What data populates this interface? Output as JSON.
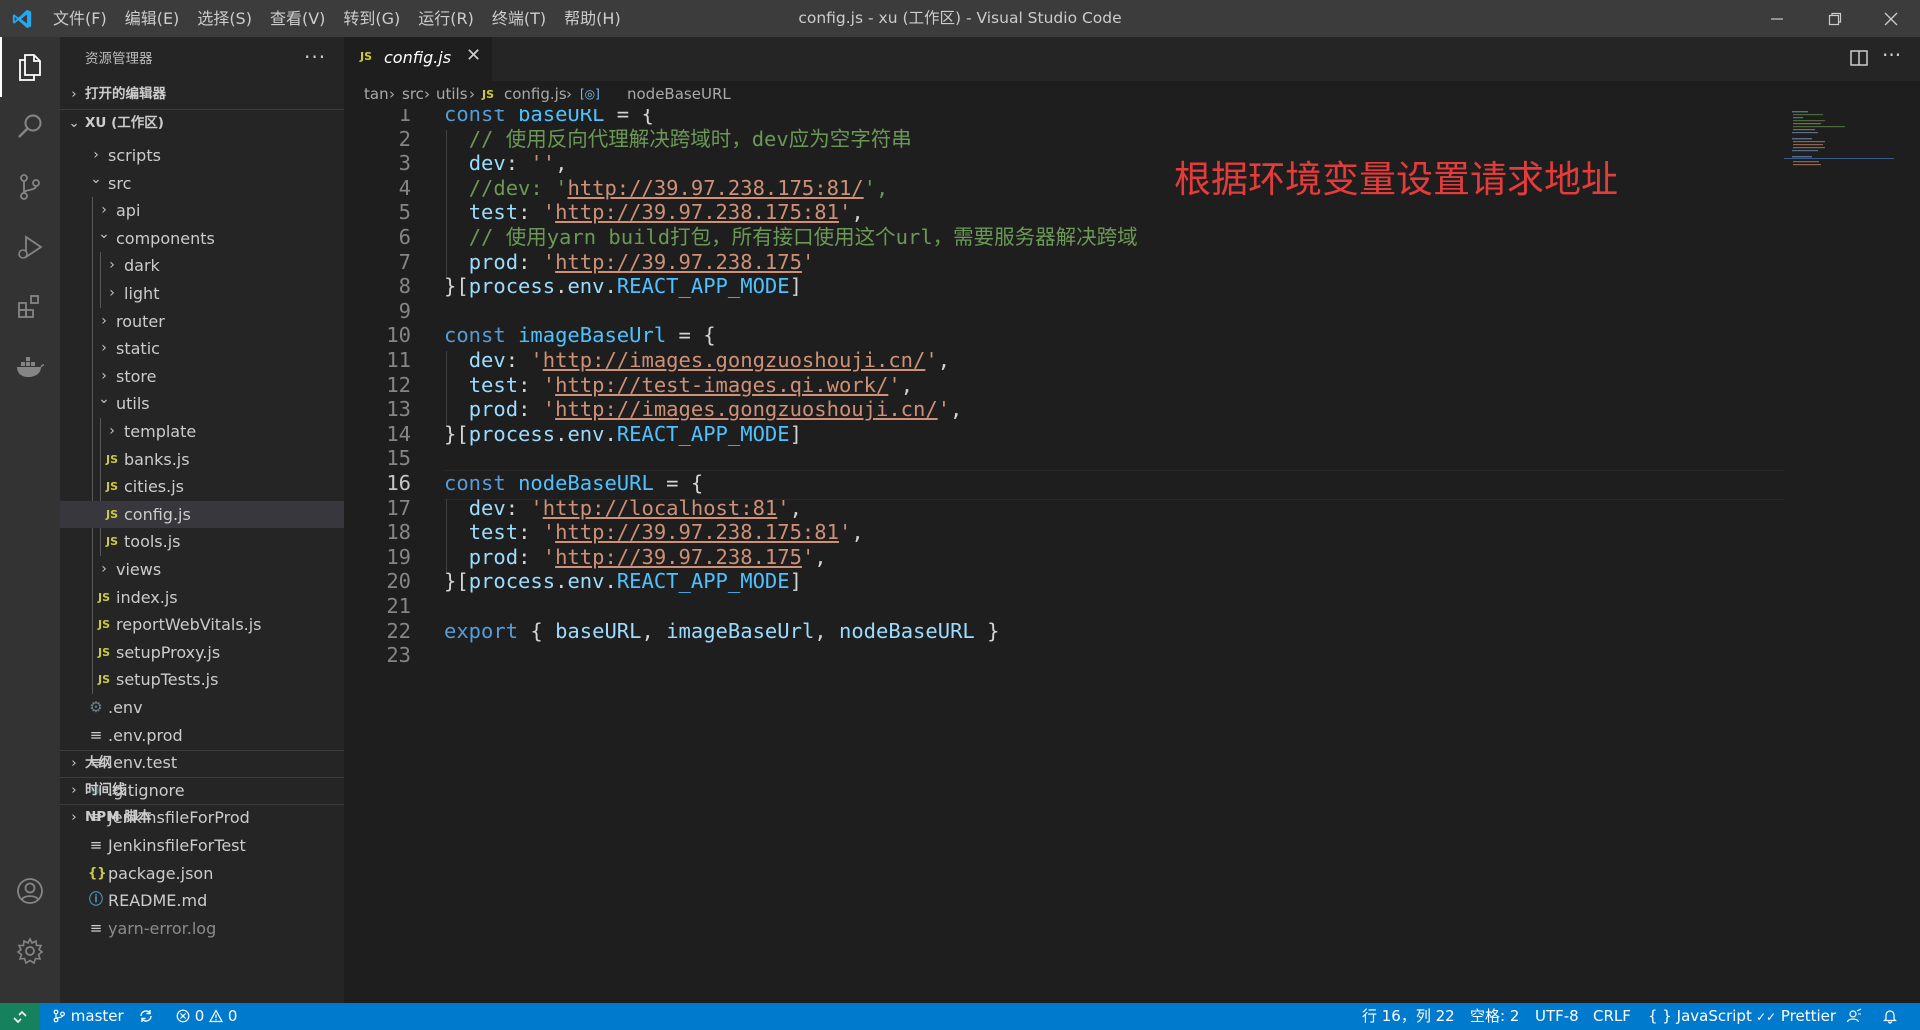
{
  "titlebar": {
    "window_title": "config.js - xu (工作区) - Visual Studio Code",
    "menus": [
      "文件(F)",
      "编辑(E)",
      "选择(S)",
      "查看(V)",
      "转到(G)",
      "运行(R)",
      "终端(T)",
      "帮助(H)"
    ]
  },
  "sidebar": {
    "title": "资源管理器",
    "open_editors": "打开的编辑器",
    "workspace": "XU (工作区)",
    "outline": "大纲",
    "timeline": "时间线",
    "npm_scripts": "NPM 脚本",
    "tree": [
      {
        "name": "scripts",
        "indent": 2,
        "type": "folder-closed"
      },
      {
        "name": "src",
        "indent": 2,
        "type": "folder-open"
      },
      {
        "name": "api",
        "indent": 3,
        "type": "folder-closed"
      },
      {
        "name": "components",
        "indent": 3,
        "type": "folder-open"
      },
      {
        "name": "dark",
        "indent": 4,
        "type": "folder-closed"
      },
      {
        "name": "light",
        "indent": 4,
        "type": "folder-closed"
      },
      {
        "name": "router",
        "indent": 3,
        "type": "folder-closed"
      },
      {
        "name": "static",
        "indent": 3,
        "type": "folder-closed"
      },
      {
        "name": "store",
        "indent": 3,
        "type": "folder-closed"
      },
      {
        "name": "utils",
        "indent": 3,
        "type": "folder-open"
      },
      {
        "name": "template",
        "indent": 4,
        "type": "folder-closed"
      },
      {
        "name": "banks.js",
        "indent": 4,
        "type": "js"
      },
      {
        "name": "cities.js",
        "indent": 4,
        "type": "js"
      },
      {
        "name": "config.js",
        "indent": 4,
        "type": "js",
        "selected": true
      },
      {
        "name": "tools.js",
        "indent": 4,
        "type": "js"
      },
      {
        "name": "views",
        "indent": 3,
        "type": "folder-closed"
      },
      {
        "name": "index.js",
        "indent": 3,
        "type": "js"
      },
      {
        "name": "reportWebVitals.js",
        "indent": 3,
        "type": "js"
      },
      {
        "name": "setupProxy.js",
        "indent": 3,
        "type": "js"
      },
      {
        "name": "setupTests.js",
        "indent": 3,
        "type": "js"
      },
      {
        "name": ".env",
        "indent": 2,
        "type": "gear"
      },
      {
        "name": ".env.prod",
        "indent": 2,
        "type": "lines"
      },
      {
        "name": ".env.test",
        "indent": 2,
        "type": "lines"
      },
      {
        "name": ".gitignore",
        "indent": 2,
        "type": "git"
      },
      {
        "name": "JenkinsfileForProd",
        "indent": 2,
        "type": "lines"
      },
      {
        "name": "JenkinsfileForTest",
        "indent": 2,
        "type": "lines"
      },
      {
        "name": "package.json",
        "indent": 2,
        "type": "json"
      },
      {
        "name": "README.md",
        "indent": 2,
        "type": "info"
      },
      {
        "name": "yarn-error.log",
        "indent": 2,
        "type": "lines",
        "dim": true
      }
    ],
    "icon_glyphs": {
      "js": "JS",
      "gear": "⚙",
      "lines": "≡",
      "git": "◆",
      "json": "{}",
      "info": "ⓘ"
    }
  },
  "editor": {
    "tab_label": "config.js",
    "tab_icon": "JS",
    "breadcrumbs": [
      "tan",
      "src",
      "utils",
      "config.js",
      "nodeBaseURL"
    ],
    "annotation": "根据环境变量设置请求地址",
    "active_line": 16,
    "lines": [
      [
        [
          "kw",
          "const "
        ],
        [
          "var",
          "baseURL"
        ],
        [
          "punc",
          " = {"
        ]
      ],
      [
        [
          "punc",
          "  "
        ],
        [
          "cmt",
          "// 使用反向代理解决跨域时，dev应为空字符串"
        ]
      ],
      [
        [
          "punc",
          "  "
        ],
        [
          "prop",
          "dev"
        ],
        [
          "punc",
          ": "
        ],
        [
          "str",
          "''"
        ],
        [
          "punc",
          ","
        ]
      ],
      [
        [
          "punc",
          "  "
        ],
        [
          "cmt",
          "//dev: '"
        ],
        [
          "url",
          "http://39.97.238.175:81/"
        ],
        [
          "cmt",
          "',"
        ]
      ],
      [
        [
          "punc",
          "  "
        ],
        [
          "prop",
          "test"
        ],
        [
          "punc",
          ": "
        ],
        [
          "str",
          "'"
        ],
        [
          "url",
          "http://39.97.238.175:81"
        ],
        [
          "str",
          "'"
        ],
        [
          "punc",
          ","
        ]
      ],
      [
        [
          "punc",
          "  "
        ],
        [
          "cmt",
          "// 使用yarn build打包，所有接口使用这个url，需要服务器解决跨域"
        ]
      ],
      [
        [
          "punc",
          "  "
        ],
        [
          "prop",
          "prod"
        ],
        [
          "punc",
          ": "
        ],
        [
          "str",
          "'"
        ],
        [
          "url",
          "http://39.97.238.175"
        ],
        [
          "str",
          "'"
        ]
      ],
      [
        [
          "punc",
          "}["
        ],
        [
          "prop",
          "process"
        ],
        [
          "punc",
          "."
        ],
        [
          "prop",
          "env"
        ],
        [
          "punc",
          "."
        ],
        [
          "const",
          "REACT_APP_MODE"
        ],
        [
          "punc",
          "]"
        ]
      ],
      [],
      [
        [
          "kw",
          "const "
        ],
        [
          "var",
          "imageBaseUrl"
        ],
        [
          "punc",
          " = {"
        ]
      ],
      [
        [
          "punc",
          "  "
        ],
        [
          "prop",
          "dev"
        ],
        [
          "punc",
          ": "
        ],
        [
          "str",
          "'"
        ],
        [
          "url",
          "http://images.gongzuoshouji.cn/"
        ],
        [
          "str",
          "'"
        ],
        [
          "punc",
          ","
        ]
      ],
      [
        [
          "punc",
          "  "
        ],
        [
          "prop",
          "test"
        ],
        [
          "punc",
          ": "
        ],
        [
          "str",
          "'"
        ],
        [
          "url",
          "http://test-images.qi.work/"
        ],
        [
          "str",
          "'"
        ],
        [
          "punc",
          ","
        ]
      ],
      [
        [
          "punc",
          "  "
        ],
        [
          "prop",
          "prod"
        ],
        [
          "punc",
          ": "
        ],
        [
          "str",
          "'"
        ],
        [
          "url",
          "http://images.gongzuoshouji.cn/"
        ],
        [
          "str",
          "'"
        ],
        [
          "punc",
          ","
        ]
      ],
      [
        [
          "punc",
          "}["
        ],
        [
          "prop",
          "process"
        ],
        [
          "punc",
          "."
        ],
        [
          "prop",
          "env"
        ],
        [
          "punc",
          "."
        ],
        [
          "const",
          "REACT_APP_MODE"
        ],
        [
          "punc",
          "]"
        ]
      ],
      [],
      [
        [
          "kw",
          "const "
        ],
        [
          "var",
          "nodeBaseURL"
        ],
        [
          "punc",
          " = {"
        ]
      ],
      [
        [
          "punc",
          "  "
        ],
        [
          "prop",
          "dev"
        ],
        [
          "punc",
          ": "
        ],
        [
          "str",
          "'"
        ],
        [
          "url",
          "http://localhost:81"
        ],
        [
          "str",
          "'"
        ],
        [
          "punc",
          ","
        ]
      ],
      [
        [
          "punc",
          "  "
        ],
        [
          "prop",
          "test"
        ],
        [
          "punc",
          ": "
        ],
        [
          "str",
          "'"
        ],
        [
          "url",
          "http://39.97.238.175:81"
        ],
        [
          "str",
          "'"
        ],
        [
          "punc",
          ","
        ]
      ],
      [
        [
          "punc",
          "  "
        ],
        [
          "prop",
          "prod"
        ],
        [
          "punc",
          ": "
        ],
        [
          "str",
          "'"
        ],
        [
          "url",
          "http://39.97.238.175"
        ],
        [
          "str",
          "'"
        ],
        [
          "punc",
          ","
        ]
      ],
      [
        [
          "punc",
          "}["
        ],
        [
          "prop",
          "process"
        ],
        [
          "punc",
          "."
        ],
        [
          "prop",
          "env"
        ],
        [
          "punc",
          "."
        ],
        [
          "const",
          "REACT_APP_MODE"
        ],
        [
          "punc",
          "]"
        ]
      ],
      [],
      [
        [
          "kw",
          "export"
        ],
        [
          "punc",
          " { "
        ],
        [
          "prop",
          "baseURL"
        ],
        [
          "punc",
          ", "
        ],
        [
          "prop",
          "imageBaseUrl"
        ],
        [
          "punc",
          ", "
        ],
        [
          "prop",
          "nodeBaseURL"
        ],
        [
          "punc",
          " }"
        ]
      ],
      []
    ]
  },
  "statusbar": {
    "branch": "master",
    "errors": "0",
    "warnings": "0",
    "cursor": "行 16，列 22",
    "spaces": "空格: 2",
    "encoding": "UTF-8",
    "eol": "CRLF",
    "language": "JavaScript",
    "formatter": "Prettier",
    "language_icon": "{ }",
    "formatter_icon": "✓✓"
  },
  "colors": {
    "accent": "#007acc",
    "remote": "#16825d",
    "annotation": "#e43b3b"
  }
}
